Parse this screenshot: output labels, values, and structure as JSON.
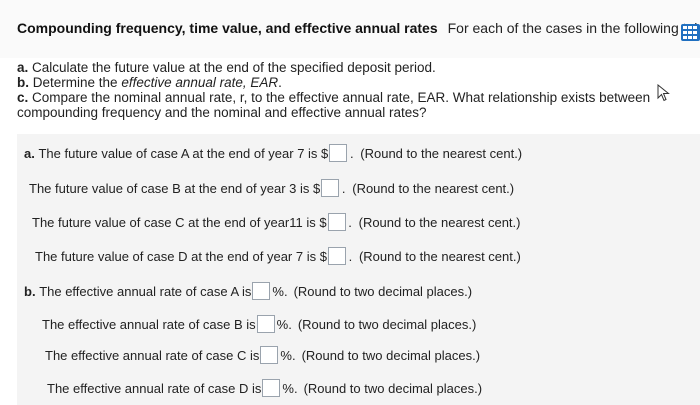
{
  "title": {
    "bold": "Compounding frequency, time value, and effective annual rates",
    "rest": "For each of the cases in the following table,"
  },
  "icons": {
    "table": "table-icon",
    "cursor": "cursor-arrow-icon"
  },
  "instructions": {
    "a": {
      "label": "a.",
      "text": "Calculate the future value at the end of the specified deposit period."
    },
    "b": {
      "label": "b.",
      "text_pre": "Determine the ",
      "text_em": "effective annual rate, EAR",
      "text_post": "."
    },
    "c": {
      "label": "c.",
      "line1": "Compare the nominal annual rate, r, to the effective annual rate, EAR. What relationship exists between",
      "line2": "compounding frequency and the nominal and effective annual rates?"
    }
  },
  "part_a": {
    "rows": [
      {
        "prefix": "a.",
        "text": "The future value of case A at the end of year 7 is $",
        "hint": "(Round to the nearest cent.)"
      },
      {
        "prefix": "",
        "text": "The future value of case B at the end of year 3 is $",
        "hint": "(Round to the nearest cent.)"
      },
      {
        "prefix": "",
        "text": "The future value of case C at the end of year11 is $",
        "hint": "(Round to the nearest cent.)"
      },
      {
        "prefix": "",
        "text": "The future value of case D at the end of year 7 is $",
        "hint": "(Round to the nearest cent.)"
      }
    ]
  },
  "part_b": {
    "rows": [
      {
        "prefix": "b.",
        "text": "The effective annual rate of case A is",
        "suffix": "%.",
        "hint": "(Round to two decimal places.)"
      },
      {
        "prefix": "",
        "text": "The effective annual rate of case B is",
        "suffix": "%.",
        "hint": "(Round to two decimal places.)"
      },
      {
        "prefix": "",
        "text": "The effective annual rate of case C is",
        "suffix": "%.",
        "hint": "(Round to two decimal places.)"
      },
      {
        "prefix": "",
        "text": "The effective annual rate of case D is",
        "suffix": "%.",
        "hint": "(Round to two decimal places.)"
      }
    ]
  }
}
